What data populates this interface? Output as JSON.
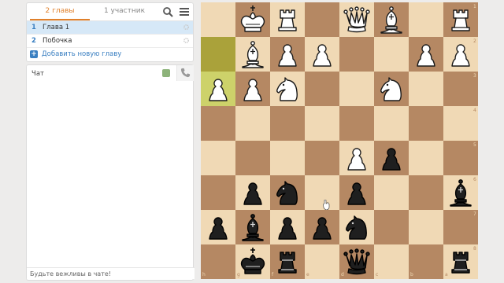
{
  "sidebar": {
    "tabs": {
      "chapters": "2 главы",
      "members": "1 участник"
    },
    "chapters": [
      {
        "num": "1",
        "name": "Глава 1"
      },
      {
        "num": "2",
        "name": "Побочка"
      }
    ],
    "add_chapter": "Добавить новую главу",
    "chat": {
      "title": "Чат",
      "placeholder": "Будьте вежливы в чате!"
    }
  },
  "board": {
    "orientation": "black",
    "files": [
      "h",
      "g",
      "f",
      "e",
      "d",
      "c",
      "b",
      "a"
    ],
    "ranks": [
      "1",
      "2",
      "3",
      "4",
      "5",
      "6",
      "7",
      "8"
    ],
    "colors": {
      "light": "#f0d9b5",
      "dark": "#b58863",
      "highlight_light": "#cdd26a",
      "highlight_dark": "#aaa23a",
      "accent": "#e0802b",
      "link": "#3a7fc1"
    },
    "highlighted_squares": [
      "h2",
      "h3"
    ],
    "pieces": [
      {
        "square": "g1",
        "type": "king",
        "color": "white"
      },
      {
        "square": "f1",
        "type": "rook",
        "color": "white"
      },
      {
        "square": "d1",
        "type": "queen",
        "color": "white"
      },
      {
        "square": "c1",
        "type": "bishop",
        "color": "white"
      },
      {
        "square": "a1",
        "type": "rook",
        "color": "white"
      },
      {
        "square": "g2",
        "type": "bishop",
        "color": "white"
      },
      {
        "square": "f2",
        "type": "pawn",
        "color": "white"
      },
      {
        "square": "e2",
        "type": "pawn",
        "color": "white"
      },
      {
        "square": "b2",
        "type": "pawn",
        "color": "white"
      },
      {
        "square": "a2",
        "type": "pawn",
        "color": "white"
      },
      {
        "square": "h3",
        "type": "pawn",
        "color": "white"
      },
      {
        "square": "g3",
        "type": "pawn",
        "color": "white"
      },
      {
        "square": "f3",
        "type": "knight",
        "color": "white"
      },
      {
        "square": "c3",
        "type": "knight",
        "color": "white"
      },
      {
        "square": "d5",
        "type": "pawn",
        "color": "white"
      },
      {
        "square": "c5",
        "type": "pawn",
        "color": "black"
      },
      {
        "square": "g6",
        "type": "pawn",
        "color": "black"
      },
      {
        "square": "f6",
        "type": "knight",
        "color": "black"
      },
      {
        "square": "d6",
        "type": "pawn",
        "color": "black"
      },
      {
        "square": "a6",
        "type": "bishop",
        "color": "black"
      },
      {
        "square": "h7",
        "type": "pawn",
        "color": "black"
      },
      {
        "square": "g7",
        "type": "bishop",
        "color": "black"
      },
      {
        "square": "f7",
        "type": "pawn",
        "color": "black"
      },
      {
        "square": "e7",
        "type": "pawn",
        "color": "black"
      },
      {
        "square": "d7",
        "type": "knight",
        "color": "black"
      },
      {
        "square": "g8",
        "type": "king",
        "color": "black"
      },
      {
        "square": "f8",
        "type": "rook",
        "color": "black"
      },
      {
        "square": "d8",
        "type": "queen",
        "color": "black"
      },
      {
        "square": "a8",
        "type": "rook",
        "color": "black"
      }
    ]
  }
}
